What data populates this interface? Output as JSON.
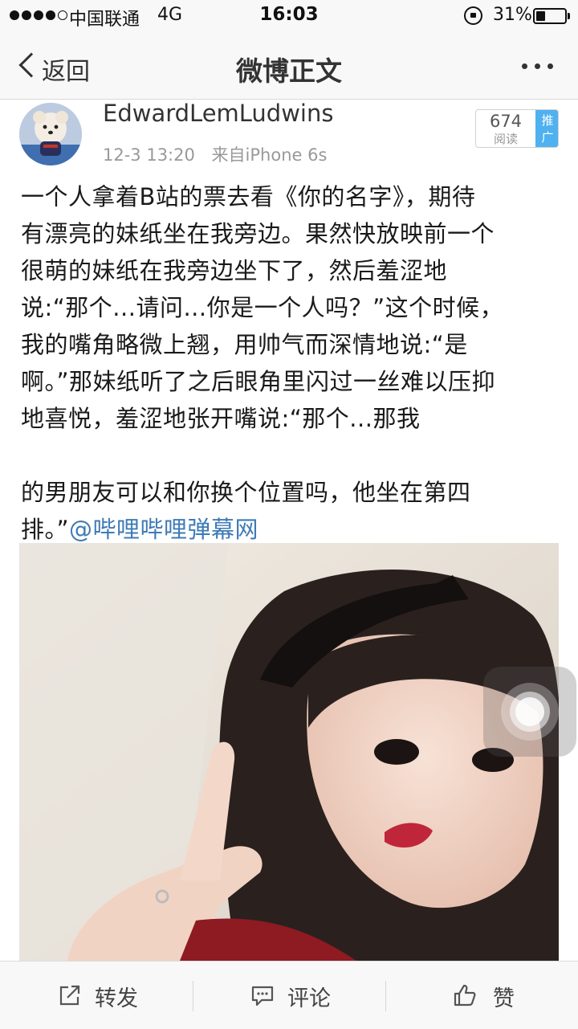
{
  "status_bar": {
    "carrier": "中国联通",
    "network": "4G",
    "time": "16:03",
    "battery_percent": "31%",
    "battery_level": 0.31,
    "signal_bars": 4,
    "signal_max": 5
  },
  "nav": {
    "back_label": "返回",
    "title": "微博正文",
    "more_icon": "more-horizontal-icon"
  },
  "post": {
    "author": "EdwardLemLudwins",
    "time": "12-3 13:20",
    "source": "来自iPhone 6s",
    "read_count": "674",
    "read_label": "阅读",
    "promote_label_1": "推",
    "promote_label_2": "广",
    "text_lines": [
      "一个人拿着B站的票去看《你的名字》，期待",
      "有漂亮的妹纸坐在我旁边。果然快放映前一个",
      "很萌的妹纸在我旁边坐下了，然后羞涩地",
      "说:“那个...请问...你是一个人吗？”这个时候，",
      "我的嘴角略微上翘，用帅气而深情地说:“是",
      "啊。”那妹纸听了之后眼角里闪过一丝难以压抑",
      "地喜悦，羞涩地张开嘴说:“那个...那我",
      "的男朋友可以和你换个位置吗，他坐在第四"
    ],
    "last_line_text": "排。”",
    "mention": "@哔哩哔哩弹幕网"
  },
  "toolbar": {
    "repost_label": "转发",
    "comment_label": "评论",
    "like_label": "赞"
  },
  "colors": {
    "mention": "#3f7bb6",
    "promote_badge": "#4fb1f0",
    "bar_bg": "#f8f8f8"
  }
}
